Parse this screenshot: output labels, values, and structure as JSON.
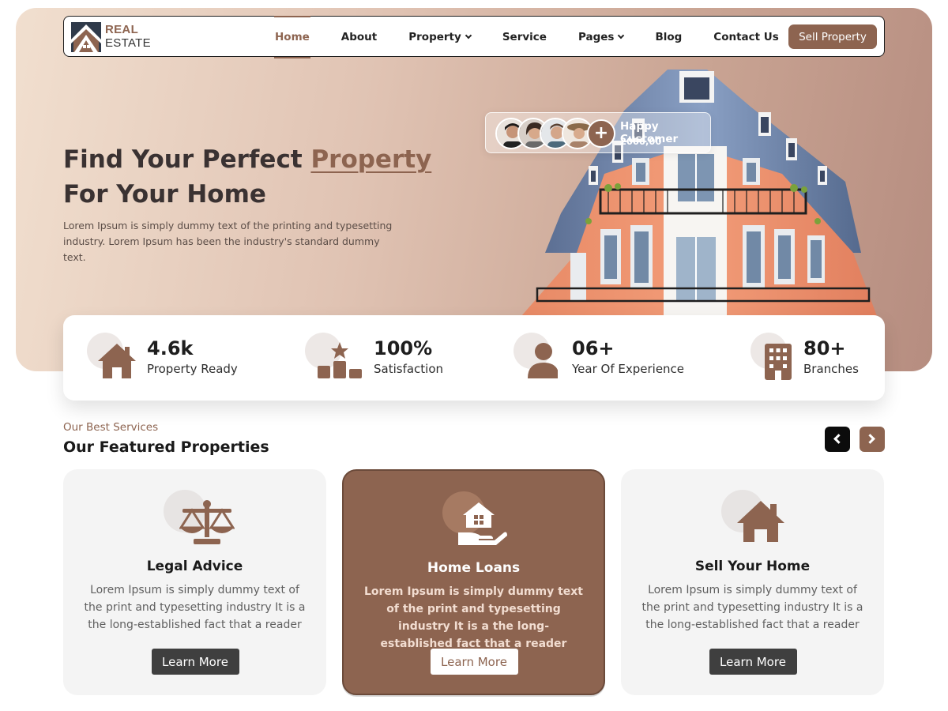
{
  "brand": {
    "line1": "REAL",
    "line2": "ESTATE"
  },
  "nav": {
    "items": [
      {
        "label": "Home",
        "active": true
      },
      {
        "label": "About"
      },
      {
        "label": "Property",
        "dropdown": true
      },
      {
        "label": "Service"
      },
      {
        "label": "Pages",
        "dropdown": true
      },
      {
        "label": "Blog"
      },
      {
        "label": "Contact Us"
      }
    ],
    "cta": "Sell Property"
  },
  "hero": {
    "title_part1": "Find Your Perfect ",
    "title_accent": "Property",
    "title_part2": "For Your Home",
    "description": "Lorem Ipsum is simply dummy text of the printing and typesetting industry. Lorem Ipsum has been the industry's standard dummy text."
  },
  "happy_customer": {
    "label": "Happy Customer",
    "count": "2000,00",
    "plus": "+"
  },
  "stats": [
    {
      "value": "4.6k",
      "label": "Property Ready",
      "icon": "house-icon"
    },
    {
      "value": "100%",
      "label": "Satisfaction",
      "icon": "podium-star-icon"
    },
    {
      "value": "06+",
      "label": "Year Of Experience",
      "icon": "person-icon"
    },
    {
      "value": "80+",
      "label": "Branches",
      "icon": "building-icon"
    }
  ],
  "services": {
    "kicker": "Our Best Services",
    "title": "Our Featured Properties",
    "cards": [
      {
        "title": "Legal Advice",
        "text": "Lorem Ipsum is simply dummy text of the print and typesetting industry It is a the long-established fact that a reader",
        "button": "Learn More",
        "icon": "scales-icon"
      },
      {
        "title": "Home Loans",
        "text": "Lorem Ipsum is simply dummy text of the print and typesetting industry It is a the long-established fact that a reader",
        "button": "Learn More",
        "icon": "house-hand-icon"
      },
      {
        "title": "Sell Your Home",
        "text": "Lorem Ipsum is simply dummy text of the print and typesetting industry It is a the long-established fact that a reader",
        "button": "Learn More",
        "icon": "house-icon"
      }
    ]
  },
  "colors": {
    "accent": "#8d6450",
    "dark": "#0c0c0c",
    "card_bg": "#f4f4f4"
  }
}
